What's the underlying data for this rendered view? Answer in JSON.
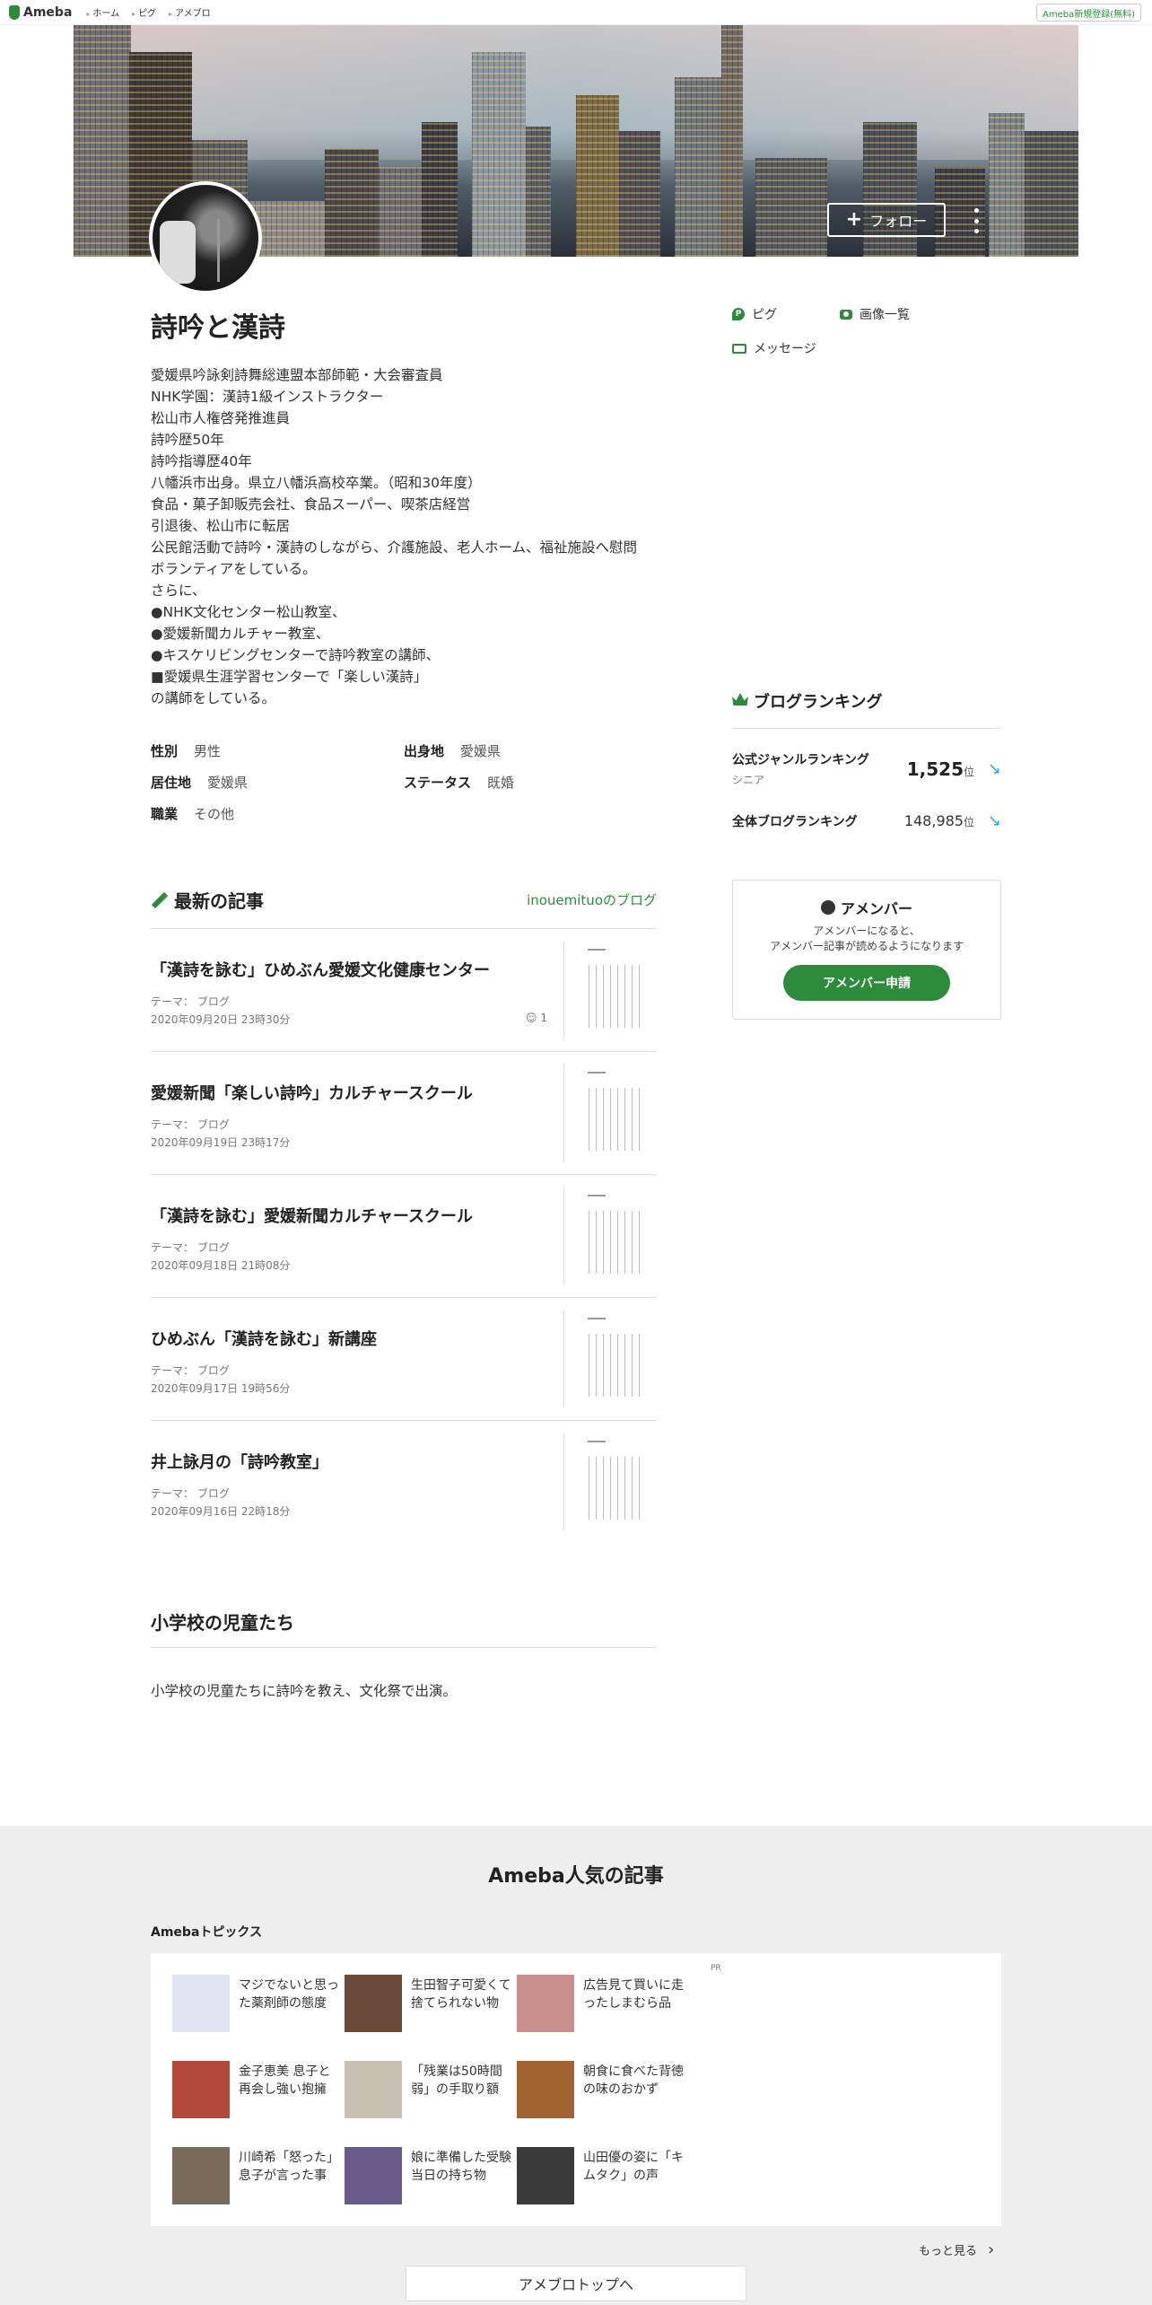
{
  "topbar": {
    "logo": "Ameba",
    "nav": [
      "ホーム",
      "ピグ",
      "アメブロ"
    ],
    "signup": "Ameba新規登録(無料)"
  },
  "hero": {
    "follow_label": "フォロー"
  },
  "profile": {
    "blog_title": "詩吟と漢詩",
    "bio": "愛媛県吟詠剣詩舞総連盟本部師範・大会審査員\nNHK学園：漢詩1級インストラクター\n松山市人権啓発推進員\n詩吟歴50年\n詩吟指導歴40年\n八幡浜市出身。県立八幡浜高校卒業。（昭和30年度）\n食品・菓子卸販売会社、食品スーパー、喫茶店経営\n引退後、松山市に転居\n公民館活動で詩吟・漢詩のしながら、介護施設、老人ホーム、福祉施設へ慰問\nボランティアをしている。\nさらに、\n●NHK文化センター松山教室、\n●愛媛新聞カルチャー教室、\n●キスケリビングセンターで詩吟教室の講師、\n■愛媛県生涯学習センターで「楽しい漢詩」\nの講師をしている。",
    "attributes": [
      {
        "label": "性別",
        "value": "男性"
      },
      {
        "label": "出身地",
        "value": "愛媛県"
      },
      {
        "label": "居住地",
        "value": "愛媛県"
      },
      {
        "label": "ステータス",
        "value": "既婚"
      },
      {
        "label": "職業",
        "value": "その他"
      }
    ]
  },
  "side_links": {
    "pigg": "ピグ",
    "images": "画像一覧",
    "message": "メッセージ"
  },
  "ranking": {
    "title": "ブログランキング",
    "genre_label": "公式ジャンルランキング",
    "genre_sub": "シニア",
    "genre_rank": "1,525",
    "overall_label": "全体ブログランキング",
    "overall_rank": "148,985",
    "unit": "位"
  },
  "amember": {
    "title": "アメンバー",
    "desc": "アメンバーになると、\nアメンバー記事が読めるようになります",
    "button": "アメンバー申請"
  },
  "latest": {
    "heading": "最新の記事",
    "blog_link": "inouemituoのブログ",
    "articles": [
      {
        "title": "「漢詩を詠む」ひめぶん愛媛文化健康センター",
        "theme": "テーマ： ブログ",
        "date": "2020年09月20日 23時30分",
        "comments": "1"
      },
      {
        "title": "愛媛新聞「楽しい詩吟」カルチャースクール",
        "theme": "テーマ： ブログ",
        "date": "2020年09月19日 23時17分",
        "comments": ""
      },
      {
        "title": "「漢詩を詠む」愛媛新聞カルチャースクール",
        "theme": "テーマ： ブログ",
        "date": "2020年09月18日 21時08分",
        "comments": ""
      },
      {
        "title": "ひめぶん「漢詩を詠む」新講座",
        "theme": "テーマ： ブログ",
        "date": "2020年09月17日 19時56分",
        "comments": ""
      },
      {
        "title": "井上詠月の「詩吟教室」",
        "theme": "テーマ： ブログ",
        "date": "2020年09月16日 22時18分",
        "comments": ""
      }
    ]
  },
  "section": {
    "title": "小学校の児童たち",
    "text": "小学校の児童たちに詩吟を教え、文化祭で出演。"
  },
  "footer": {
    "title": "Ameba人気の記事",
    "topics_label": "Amebaトピックス",
    "pr": "PR",
    "topics": [
      {
        "caption": "マジでないと思った薬剤師の態度",
        "color": "#dfe6ef"
      },
      {
        "caption": "生田智子可愛くて捨てられない物",
        "color": "#6b4a3a"
      },
      {
        "caption": "広告見て買いに走ったしまむら品",
        "color": "#c98f8a"
      },
      {
        "caption": "金子恵美 息子と再会し強い抱擁",
        "color": "#b2483a"
      },
      {
        "caption": "「残業は50時間弱」の手取り額",
        "color": "#c8c0b0"
      },
      {
        "caption": "朝食に食べた背徳の味のおかず",
        "color": "#a0622e"
      },
      {
        "caption": "川崎希「怒った」息子が言った事",
        "color": "#7a6a58"
      },
      {
        "caption": "娘に準備した受験当日の持ち物",
        "color": "#6a5a8a"
      },
      {
        "caption": "山田優の姿に「キムタク」の声",
        "color": "#3a3a3a"
      }
    ],
    "more": "もっと見る",
    "top_button": "アメブロトップへ"
  }
}
